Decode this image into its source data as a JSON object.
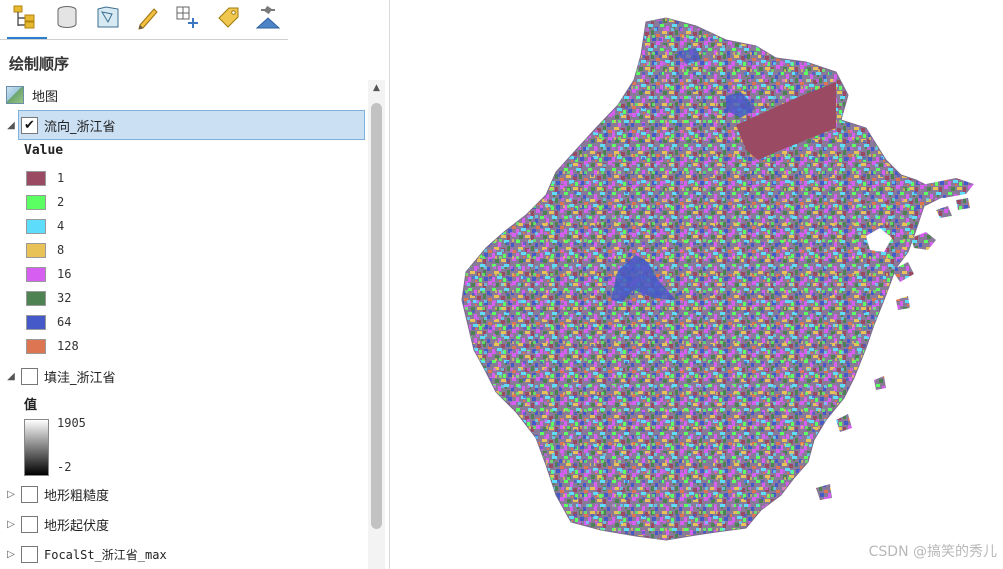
{
  "toolbar": {
    "tools": [
      {
        "icon": "list-by-drawing-order-icon",
        "active": true
      },
      {
        "icon": "list-by-data-source-icon"
      },
      {
        "icon": "list-by-selection-icon"
      },
      {
        "icon": "list-by-editing-icon"
      },
      {
        "icon": "list-by-snapping-icon"
      },
      {
        "icon": "list-by-labeling-icon"
      },
      {
        "icon": "list-by-perspective-imagery-icon"
      }
    ],
    "accent_color": "#2a7fd0"
  },
  "contents": {
    "title": "绘制顺序",
    "map_label": "地图",
    "layers": [
      {
        "name": "流向_浙江省",
        "checked": true,
        "expanded": true,
        "selected": true,
        "legend_heading": "Value",
        "classes": [
          {
            "value": "1",
            "color": "#9a4a62"
          },
          {
            "value": "2",
            "color": "#5cff61"
          },
          {
            "value": "4",
            "color": "#5ddcfb"
          },
          {
            "value": "8",
            "color": "#e8c256"
          },
          {
            "value": "16",
            "color": "#d65ff2"
          },
          {
            "value": "32",
            "color": "#4f8253"
          },
          {
            "value": "64",
            "color": "#4559c9"
          },
          {
            "value": "128",
            "color": "#dd7552"
          }
        ]
      },
      {
        "name": "填洼_浙江省",
        "checked": false,
        "expanded": true,
        "legend_heading": "值",
        "ramp": {
          "max": "1905",
          "min": "-2"
        }
      },
      {
        "name": "地形粗糙度",
        "checked": false,
        "expanded": false
      },
      {
        "name": "地形起伏度",
        "checked": false,
        "expanded": false
      },
      {
        "name": "FocalSt_浙江省_max",
        "checked": false,
        "expanded": false
      }
    ]
  },
  "map": {
    "watermark": "CSDN @搞笑的秀儿"
  }
}
